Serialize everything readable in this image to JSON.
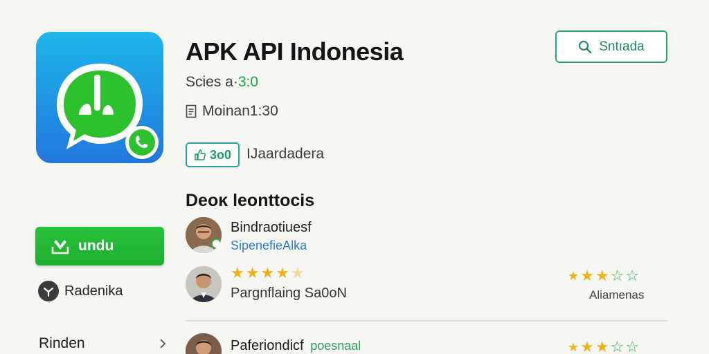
{
  "app": {
    "title": "APK API Indonesia",
    "meta_prefix": "Scies a·",
    "meta_value": "3:0",
    "size_label": "Moinan1:30",
    "likes": "3o0",
    "developer": "IJaardadera",
    "icon_colors": {
      "background": "#1f8fe3",
      "bubble": "#2ec12e"
    }
  },
  "search_button": {
    "label": "Sntıada"
  },
  "download_button": {
    "label": "undu"
  },
  "report": {
    "label": "Radenika"
  },
  "related": {
    "label": "Rinden"
  },
  "reviews": {
    "title": "Deoĸ leonttocis",
    "items": [
      {
        "name": "Bindraotiuesf",
        "sub": "SipenefieAlka"
      },
      {
        "text": "Pargnflaing Sa0oN",
        "stars_text": "★★★★",
        "rating_label": "Aliamenas"
      },
      {
        "name": "Paferiondicf",
        "sub": "poesnaal"
      }
    ]
  }
}
